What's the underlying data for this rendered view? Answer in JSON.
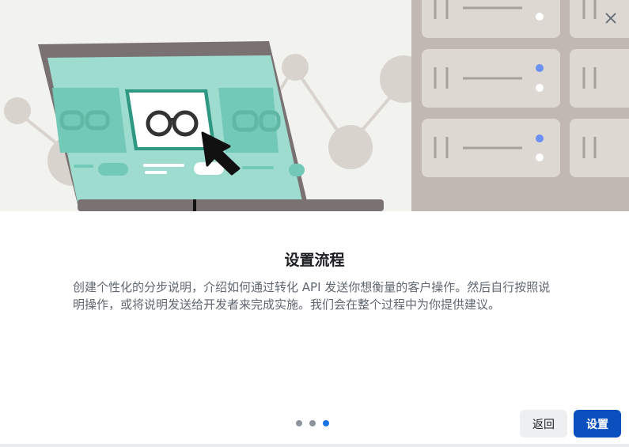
{
  "dialog": {
    "title": "设置流程",
    "description": "创建个性化的分步说明，介绍如何通过转化 API 发送你想衡量的客户操作。然后自行按照说明操作，或将说明发送给开发者来完成实施。我们会在整个过程中为你提供建议。",
    "close_icon": "close-icon",
    "illustration_icon": "laptop-servers-illustration"
  },
  "pagination": {
    "total": 3,
    "current": 3
  },
  "buttons": {
    "back_label": "返回",
    "setup_label": "设置"
  },
  "colors": {
    "primary": "#0a4fbe",
    "dot_active": "#1b74e4",
    "dot_inactive": "#8d949e",
    "illustration_teal": "#9edccf",
    "illustration_bg": "#f2f2ef",
    "server_bg": "#c0b8b1"
  }
}
